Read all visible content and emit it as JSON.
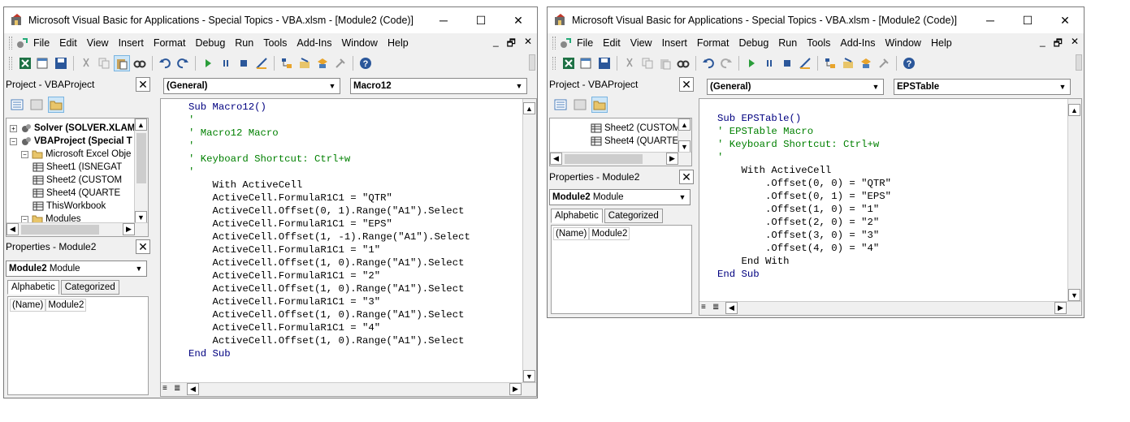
{
  "left": {
    "title": "Microsoft Visual Basic for Applications - Special Topics - VBA.xlsm - [Module2 (Code)]",
    "menu": [
      "File",
      "Edit",
      "View",
      "Insert",
      "Format",
      "Debug",
      "Run",
      "Tools",
      "Add-Ins",
      "Window",
      "Help"
    ],
    "project_title": "Project - VBAProject",
    "tree": [
      {
        "label": "Solver (SOLVER.XLAM",
        "bold": true,
        "pm": "+"
      },
      {
        "label": "VBAProject (Special T",
        "bold": true,
        "pm": "−"
      },
      {
        "label": "Microsoft Excel Obje",
        "bold": false,
        "pm": "−"
      },
      {
        "label": "Sheet1 (ISNEGAT",
        "bold": false,
        "pm": ""
      },
      {
        "label": "Sheet2 (CUSTOM",
        "bold": false,
        "pm": ""
      },
      {
        "label": "Sheet4 (QUARTE",
        "bold": false,
        "pm": ""
      },
      {
        "label": "ThisWorkbook",
        "bold": false,
        "pm": ""
      },
      {
        "label": "Modules",
        "bold": false,
        "pm": "−"
      }
    ],
    "props_title": "Properties - Module2",
    "props_combo_bold": "Module2",
    "props_combo_rest": "Module",
    "tab_alpha": "Alphabetic",
    "tab_cat": "Categorized",
    "prop_name": "(Name)",
    "prop_value": "Module2",
    "combo_general": "(General)",
    "combo_proc": "Macro12",
    "code": [
      {
        "t": "Sub Macro12()",
        "c": "kw"
      },
      {
        "t": "'",
        "c": "cm"
      },
      {
        "t": "' Macro12 Macro",
        "c": "cm"
      },
      {
        "t": "'",
        "c": "cm"
      },
      {
        "t": "' Keyboard Shortcut: Ctrl+w",
        "c": "cm"
      },
      {
        "t": "'",
        "c": "cm"
      },
      {
        "t": "    With ActiveCell",
        "c": ""
      },
      {
        "t": "    ActiveCell.FormulaR1C1 = \"QTR\"",
        "c": ""
      },
      {
        "t": "    ActiveCell.Offset(0, 1).Range(\"A1\").Select",
        "c": ""
      },
      {
        "t": "    ActiveCell.FormulaR1C1 = \"EPS\"",
        "c": ""
      },
      {
        "t": "    ActiveCell.Offset(1, -1).Range(\"A1\").Select",
        "c": ""
      },
      {
        "t": "    ActiveCell.FormulaR1C1 = \"1\"",
        "c": ""
      },
      {
        "t": "    ActiveCell.Offset(1, 0).Range(\"A1\").Select",
        "c": ""
      },
      {
        "t": "    ActiveCell.FormulaR1C1 = \"2\"",
        "c": ""
      },
      {
        "t": "    ActiveCell.Offset(1, 0).Range(\"A1\").Select",
        "c": ""
      },
      {
        "t": "    ActiveCell.FormulaR1C1 = \"3\"",
        "c": ""
      },
      {
        "t": "    ActiveCell.Offset(1, 0).Range(\"A1\").Select",
        "c": ""
      },
      {
        "t": "    ActiveCell.FormulaR1C1 = \"4\"",
        "c": ""
      },
      {
        "t": "    ActiveCell.Offset(1, 0).Range(\"A1\").Select",
        "c": ""
      },
      {
        "t": "End Sub",
        "c": "kw"
      }
    ]
  },
  "right": {
    "title": "Microsoft Visual Basic for Applications - Special Topics - VBA.xlsm - [Module2 (Code)]",
    "menu": [
      "File",
      "Edit",
      "View",
      "Insert",
      "Format",
      "Debug",
      "Run",
      "Tools",
      "Add-Ins",
      "Window",
      "Help"
    ],
    "project_title": "Project - VBAProject",
    "tree": [
      {
        "label": "Sheet2 (CUSTOM",
        "bold": false,
        "pm": ""
      },
      {
        "label": "Sheet4 (QUARTE",
        "bold": false,
        "pm": ""
      }
    ],
    "props_title": "Properties - Module2",
    "props_combo_bold": "Module2",
    "props_combo_rest": "Module",
    "tab_alpha": "Alphabetic",
    "tab_cat": "Categorized",
    "prop_name": "(Name)",
    "prop_value": "Module2",
    "combo_general": "(General)",
    "combo_proc": "EPSTable",
    "code": [
      {
        "t": "Sub EPSTable()",
        "c": "kw"
      },
      {
        "t": "' EPSTable Macro",
        "c": "cm"
      },
      {
        "t": "' Keyboard Shortcut: Ctrl+w",
        "c": "cm"
      },
      {
        "t": "'",
        "c": "cm"
      },
      {
        "t": "    With ActiveCell",
        "c": ""
      },
      {
        "t": "        .Offset(0, 0) = \"QTR\"",
        "c": ""
      },
      {
        "t": "        .Offset(0, 1) = \"EPS\"",
        "c": ""
      },
      {
        "t": "        .Offset(1, 0) = \"1\"",
        "c": ""
      },
      {
        "t": "        .Offset(2, 0) = \"2\"",
        "c": ""
      },
      {
        "t": "        .Offset(3, 0) = \"3\"",
        "c": ""
      },
      {
        "t": "        .Offset(4, 0) = \"4\"",
        "c": ""
      },
      {
        "t": "    End With",
        "c": ""
      },
      {
        "t": "End Sub",
        "c": "kw"
      }
    ]
  },
  "ui": {
    "minimize": "─",
    "maximize": "☐",
    "close": "✕",
    "doc_min": "_",
    "doc_restore": "🗗",
    "doc_close": "✕",
    "pane_close": "✕",
    "arrow_down": "▼",
    "arrow_up": "▲",
    "arrow_left": "◀",
    "arrow_right": "▶"
  },
  "icons": [
    "vba-app-icon",
    "view-excel-icon",
    "insert-module-icon",
    "save-icon",
    "cut-icon",
    "copy-icon",
    "paste-icon",
    "find-icon",
    "undo-icon",
    "redo-icon",
    "run-icon",
    "break-icon",
    "reset-icon",
    "design-mode-icon",
    "project-explorer-icon",
    "properties-icon",
    "object-browser-icon",
    "toolbox-icon",
    "help-icon"
  ]
}
